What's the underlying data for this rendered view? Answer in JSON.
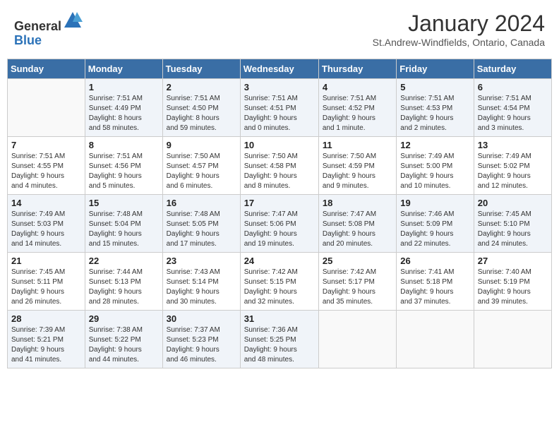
{
  "header": {
    "logo_general": "General",
    "logo_blue": "Blue",
    "month_title": "January 2024",
    "location": "St.Andrew-Windfields, Ontario, Canada"
  },
  "weekdays": [
    "Sunday",
    "Monday",
    "Tuesday",
    "Wednesday",
    "Thursday",
    "Friday",
    "Saturday"
  ],
  "weeks": [
    [
      {
        "day": "",
        "info": ""
      },
      {
        "day": "1",
        "info": "Sunrise: 7:51 AM\nSunset: 4:49 PM\nDaylight: 8 hours\nand 58 minutes."
      },
      {
        "day": "2",
        "info": "Sunrise: 7:51 AM\nSunset: 4:50 PM\nDaylight: 8 hours\nand 59 minutes."
      },
      {
        "day": "3",
        "info": "Sunrise: 7:51 AM\nSunset: 4:51 PM\nDaylight: 9 hours\nand 0 minutes."
      },
      {
        "day": "4",
        "info": "Sunrise: 7:51 AM\nSunset: 4:52 PM\nDaylight: 9 hours\nand 1 minute."
      },
      {
        "day": "5",
        "info": "Sunrise: 7:51 AM\nSunset: 4:53 PM\nDaylight: 9 hours\nand 2 minutes."
      },
      {
        "day": "6",
        "info": "Sunrise: 7:51 AM\nSunset: 4:54 PM\nDaylight: 9 hours\nand 3 minutes."
      }
    ],
    [
      {
        "day": "7",
        "info": "Sunrise: 7:51 AM\nSunset: 4:55 PM\nDaylight: 9 hours\nand 4 minutes."
      },
      {
        "day": "8",
        "info": "Sunrise: 7:51 AM\nSunset: 4:56 PM\nDaylight: 9 hours\nand 5 minutes."
      },
      {
        "day": "9",
        "info": "Sunrise: 7:50 AM\nSunset: 4:57 PM\nDaylight: 9 hours\nand 6 minutes."
      },
      {
        "day": "10",
        "info": "Sunrise: 7:50 AM\nSunset: 4:58 PM\nDaylight: 9 hours\nand 8 minutes."
      },
      {
        "day": "11",
        "info": "Sunrise: 7:50 AM\nSunset: 4:59 PM\nDaylight: 9 hours\nand 9 minutes."
      },
      {
        "day": "12",
        "info": "Sunrise: 7:49 AM\nSunset: 5:00 PM\nDaylight: 9 hours\nand 10 minutes."
      },
      {
        "day": "13",
        "info": "Sunrise: 7:49 AM\nSunset: 5:02 PM\nDaylight: 9 hours\nand 12 minutes."
      }
    ],
    [
      {
        "day": "14",
        "info": "Sunrise: 7:49 AM\nSunset: 5:03 PM\nDaylight: 9 hours\nand 14 minutes."
      },
      {
        "day": "15",
        "info": "Sunrise: 7:48 AM\nSunset: 5:04 PM\nDaylight: 9 hours\nand 15 minutes."
      },
      {
        "day": "16",
        "info": "Sunrise: 7:48 AM\nSunset: 5:05 PM\nDaylight: 9 hours\nand 17 minutes."
      },
      {
        "day": "17",
        "info": "Sunrise: 7:47 AM\nSunset: 5:06 PM\nDaylight: 9 hours\nand 19 minutes."
      },
      {
        "day": "18",
        "info": "Sunrise: 7:47 AM\nSunset: 5:08 PM\nDaylight: 9 hours\nand 20 minutes."
      },
      {
        "day": "19",
        "info": "Sunrise: 7:46 AM\nSunset: 5:09 PM\nDaylight: 9 hours\nand 22 minutes."
      },
      {
        "day": "20",
        "info": "Sunrise: 7:45 AM\nSunset: 5:10 PM\nDaylight: 9 hours\nand 24 minutes."
      }
    ],
    [
      {
        "day": "21",
        "info": "Sunrise: 7:45 AM\nSunset: 5:11 PM\nDaylight: 9 hours\nand 26 minutes."
      },
      {
        "day": "22",
        "info": "Sunrise: 7:44 AM\nSunset: 5:13 PM\nDaylight: 9 hours\nand 28 minutes."
      },
      {
        "day": "23",
        "info": "Sunrise: 7:43 AM\nSunset: 5:14 PM\nDaylight: 9 hours\nand 30 minutes."
      },
      {
        "day": "24",
        "info": "Sunrise: 7:42 AM\nSunset: 5:15 PM\nDaylight: 9 hours\nand 32 minutes."
      },
      {
        "day": "25",
        "info": "Sunrise: 7:42 AM\nSunset: 5:17 PM\nDaylight: 9 hours\nand 35 minutes."
      },
      {
        "day": "26",
        "info": "Sunrise: 7:41 AM\nSunset: 5:18 PM\nDaylight: 9 hours\nand 37 minutes."
      },
      {
        "day": "27",
        "info": "Sunrise: 7:40 AM\nSunset: 5:19 PM\nDaylight: 9 hours\nand 39 minutes."
      }
    ],
    [
      {
        "day": "28",
        "info": "Sunrise: 7:39 AM\nSunset: 5:21 PM\nDaylight: 9 hours\nand 41 minutes."
      },
      {
        "day": "29",
        "info": "Sunrise: 7:38 AM\nSunset: 5:22 PM\nDaylight: 9 hours\nand 44 minutes."
      },
      {
        "day": "30",
        "info": "Sunrise: 7:37 AM\nSunset: 5:23 PM\nDaylight: 9 hours\nand 46 minutes."
      },
      {
        "day": "31",
        "info": "Sunrise: 7:36 AM\nSunset: 5:25 PM\nDaylight: 9 hours\nand 48 minutes."
      },
      {
        "day": "",
        "info": ""
      },
      {
        "day": "",
        "info": ""
      },
      {
        "day": "",
        "info": ""
      }
    ]
  ]
}
